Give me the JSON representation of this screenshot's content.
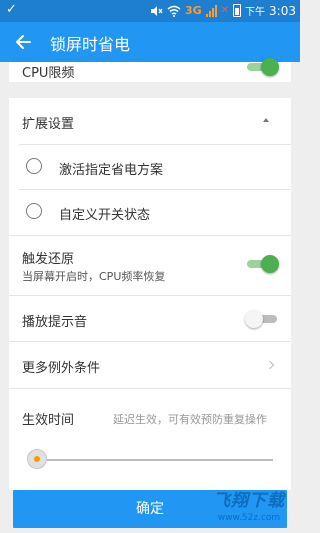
{
  "status_bar": {
    "left_symbol": "✓",
    "network": "3G",
    "signal_marks": "?",
    "alert_mark": "✕",
    "time_prefix": "下午",
    "time": "3:03"
  },
  "app_bar": {
    "title": "锁屏时省电",
    "back_icon": "arrow-left-icon"
  },
  "top_card": {
    "label": "CPU限频",
    "toggle_on": true
  },
  "section": {
    "title": "扩展设置",
    "expanded": true
  },
  "options": [
    {
      "label": "激活指定省电方案",
      "selected": false
    },
    {
      "label": "自定义开关状态",
      "selected": false
    }
  ],
  "restore": {
    "label": "触发还原",
    "sublabel": "当屏幕开启时，CPU频率恢复",
    "toggle_on": true
  },
  "sound": {
    "label": "播放提示音",
    "toggle_on": false
  },
  "exceptions": {
    "label": "更多例外条件"
  },
  "effect_time": {
    "label": "生效时间",
    "hint": "延迟生效，可有效预防重复操作",
    "slider_value": 0
  },
  "confirm_button": {
    "label": "确定"
  },
  "watermark": {
    "title": "飞翔下载",
    "url": "www.52z.com"
  },
  "colors": {
    "primary": "#2196f3",
    "status_bar": "#1e7fd0",
    "toggle_on": "#4caf50",
    "slider_accent": "#ff9800"
  }
}
